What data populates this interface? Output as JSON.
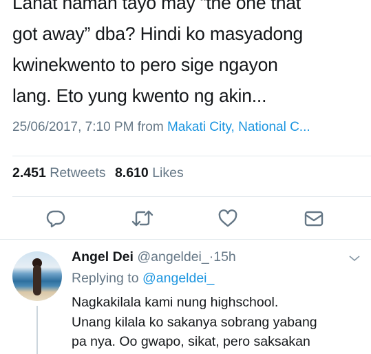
{
  "tweet": {
    "lines": [
      "Lahat naman tayo may “the one that",
      "got away” dba? Hindi ko masyadong",
      "kwinekwento to pero sige ngayon",
      "lang. Eto yung kwento ng akin..."
    ],
    "timestamp": "25/06/2017, 7:10 PM",
    "from_label": "from",
    "location": "Makati City, National C..."
  },
  "stats": {
    "retweets_count": "2.451",
    "retweets_label": "Retweets",
    "likes_count": "8.610",
    "likes_label": "Likes"
  },
  "actions": {
    "icons": [
      "reply-icon",
      "retweet-icon",
      "like-icon",
      "direct-message-icon"
    ],
    "icon_color": "#657786"
  },
  "reply": {
    "name": "Angel Dei",
    "handle": "@angeldei_",
    "separator": "·",
    "time": "15h",
    "replying_label": "Replying to",
    "replying_to": "@angeldei_",
    "lines": [
      "Nagkakilala kami nung highschool.",
      "Unang kilala ko sakanya sobrang yabang",
      "pa nya. Oo gwapo, sikat, pero saksakan"
    ]
  },
  "colors": {
    "text": "#14171a",
    "secondary": "#657786",
    "link": "#1b95e0",
    "divider": "#e1e8ed"
  }
}
